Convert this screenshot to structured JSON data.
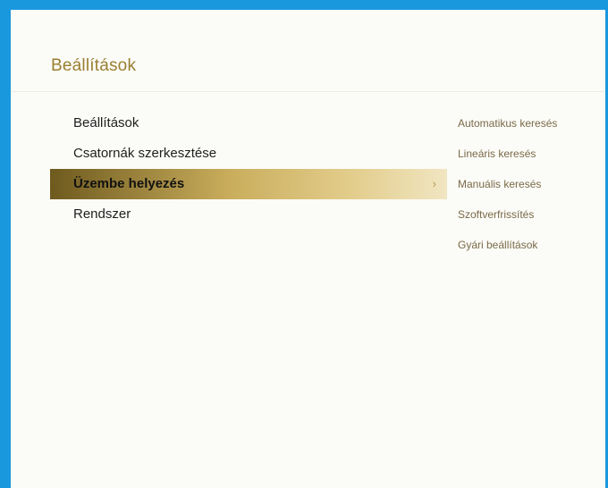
{
  "page": {
    "title": "Beállítások"
  },
  "menu": {
    "items": [
      {
        "label": "Beállítások",
        "selected": false
      },
      {
        "label": "Csatornák szerkesztése",
        "selected": false
      },
      {
        "label": "Üzembe helyezés",
        "selected": true
      },
      {
        "label": "Rendszer",
        "selected": false
      }
    ],
    "chevron": "›"
  },
  "submenu": {
    "items": [
      {
        "label": "Automatikus keresés"
      },
      {
        "label": "Lineáris keresés"
      },
      {
        "label": "Manuális keresés"
      },
      {
        "label": "Szoftverfrissítés"
      },
      {
        "label": "Gyári beállítások"
      }
    ]
  },
  "colors": {
    "frame": "#1a98de",
    "title": "#9a7f30",
    "highlight_start": "#6e5a1e",
    "highlight_end": "#f1e6c2"
  }
}
